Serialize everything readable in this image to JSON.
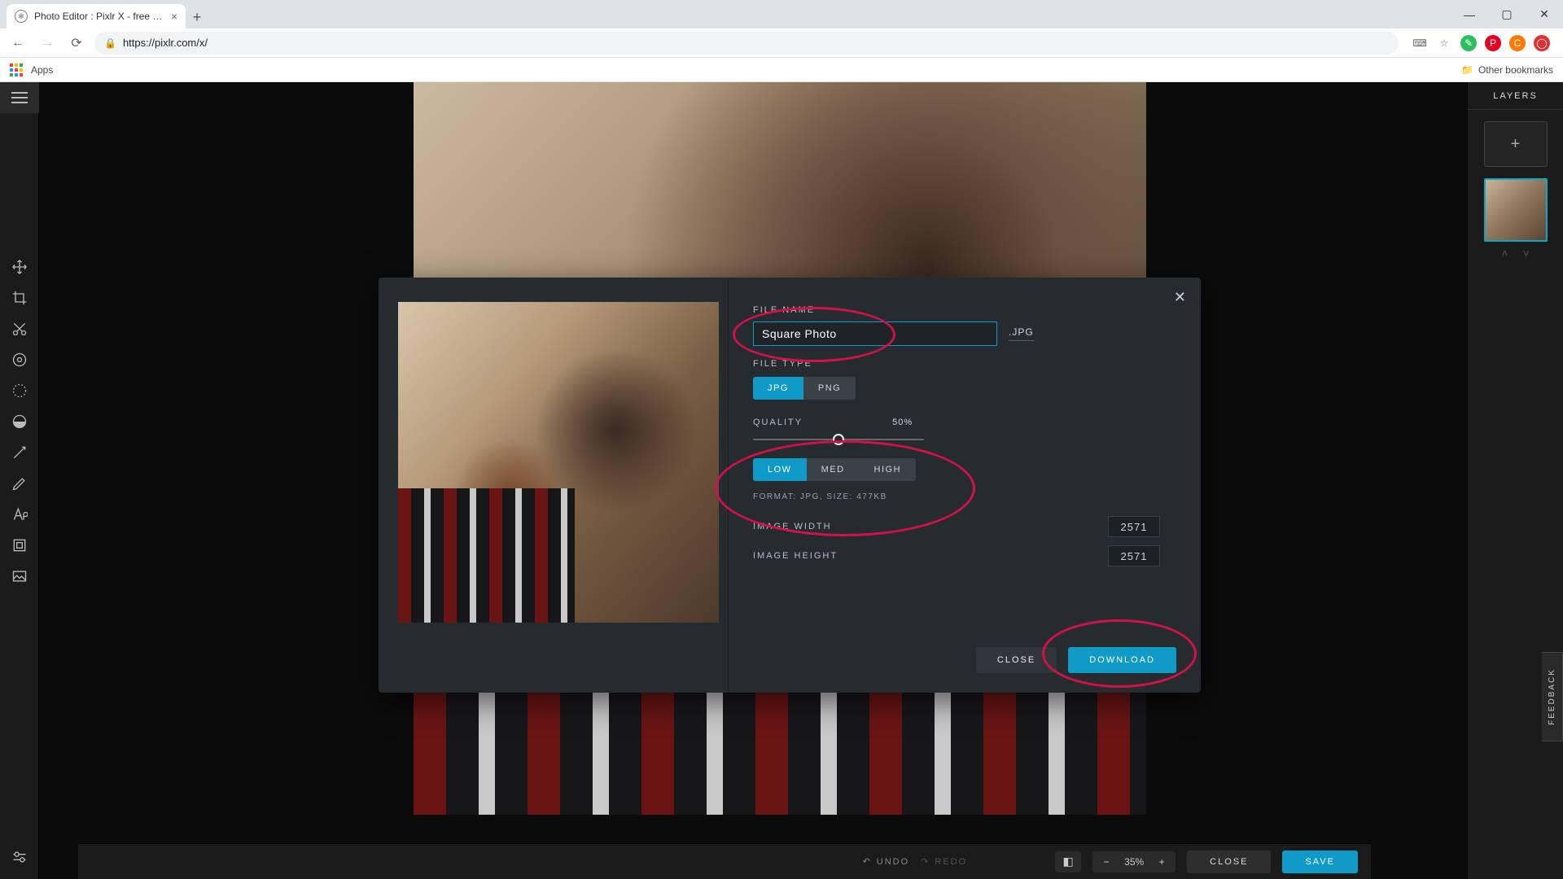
{
  "browser": {
    "tab_title": "Photo Editor : Pixlr X - free image…",
    "url": "https://pixlr.com/x/",
    "apps_label": "Apps",
    "other_bookmarks": "Other bookmarks"
  },
  "toolbar_icons": [
    "move-icon",
    "crop-icon",
    "cut-icon",
    "adjust-icon",
    "effects-icon",
    "liquify-icon",
    "heal-icon",
    "draw-icon",
    "text-icon",
    "element-icon",
    "image-icon"
  ],
  "layers": {
    "title": "LAYERS"
  },
  "bottombar": {
    "undo": "UNDO",
    "redo": "REDO",
    "zoom": "35%",
    "close": "CLOSE",
    "save": "SAVE"
  },
  "feedback": "FEEDBACK",
  "dialog": {
    "filename_label": "FILE NAME",
    "filename_value": "Square Photo",
    "filename_ext": ".JPG",
    "filetype_label": "FILE TYPE",
    "filetype_options": [
      "JPG",
      "PNG"
    ],
    "filetype_selected": "JPG",
    "quality_label": "QUALITY",
    "quality_value": "50%",
    "quality_options": [
      "LOW",
      "MED",
      "HIGH"
    ],
    "quality_selected": "LOW",
    "meta": "FORMAT: JPG, SIZE: 477KB",
    "width_label": "IMAGE WIDTH",
    "width_value": "2571",
    "height_label": "IMAGE HEIGHT",
    "height_value": "2571",
    "close": "CLOSE",
    "download": "DOWNLOAD"
  }
}
